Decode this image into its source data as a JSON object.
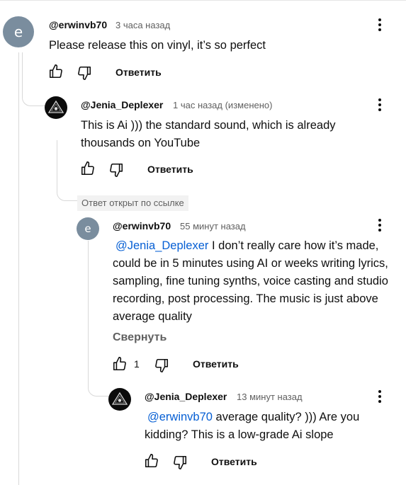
{
  "comments": [
    {
      "avatar_letter": "e",
      "author": "@erwinvb70",
      "time": "3 часа назад",
      "text": "Please release this on vinyl, it’s so perfect",
      "reply_label": "Ответить"
    },
    {
      "author": "@Jenia_Deplexer",
      "time": "1 час назад (изменено)",
      "text": "This is Ai  )))  the standard sound, which is already thousands on YouTube",
      "reply_label": "Ответить"
    },
    {
      "avatar_letter": "e",
      "author": "@erwinvb70",
      "time": "55 минут назад",
      "mention": "@Jenia_Deplexer",
      "text": " I don’t really care how it’s made, could be in 5 minutes using AI or weeks writing lyrics, sampling, fine tuning synths, voice casting and studio recording, post processing. The music is just above average quality",
      "collapse_label": "Свернуть",
      "likes": "1",
      "reply_label": "Ответить"
    },
    {
      "author": "@Jenia_Deplexer",
      "time": "13 минут назад",
      "mention": "@erwinvb70",
      "text": "  average quality? ))) Are you kidding? This is a low-grade Ai slope",
      "reply_label": "Ответить"
    }
  ],
  "linked_reply_tag": "Ответ открыт по ссылке",
  "icons": {
    "like": "thumbs-up-icon",
    "dislike": "thumbs-down-icon",
    "menu": "more-vert-icon"
  },
  "colors": {
    "mention": "#065fd4",
    "avatar_letter_bg": "#7a8d9e",
    "secondary_text": "#606060"
  }
}
